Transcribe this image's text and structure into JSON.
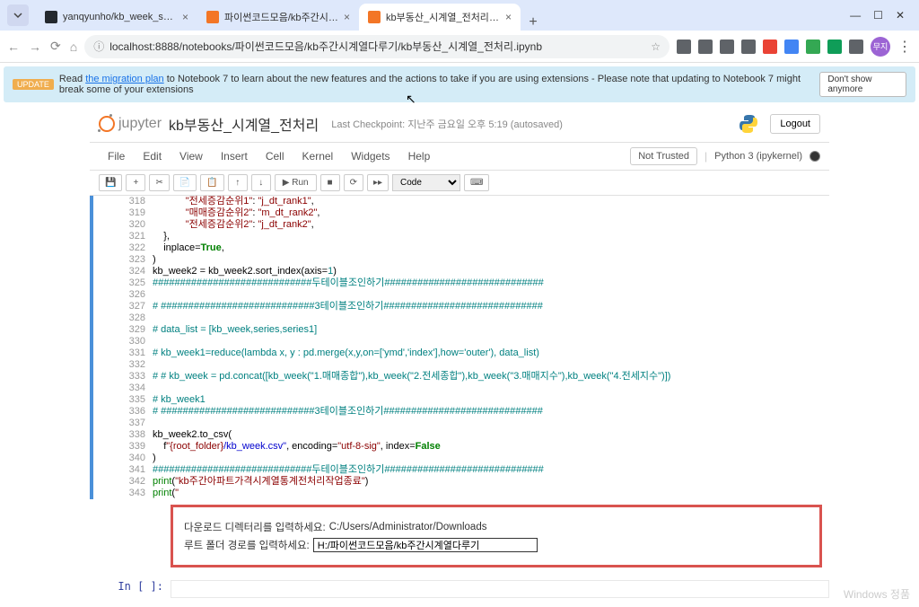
{
  "browser": {
    "tabs": [
      {
        "title": "yanqyunho/kb_week_series_pr...",
        "favicon_color": "#24292e"
      },
      {
        "title": "파이썬코드모음/kb주간시계열...",
        "favicon_color": "#f37626"
      },
      {
        "title": "kb부동산_시계열_전처리 - Jup...",
        "favicon_color": "#f37626"
      }
    ],
    "url": "localhost:8888/notebooks/파이썬코드모음/kb주간시계열다루기/kb부동산_시계열_전처리.ipynb",
    "ext_colors": [
      "#5f6368",
      "#5f6368",
      "#5f6368",
      "#5f6368",
      "#ea4335",
      "#34a853",
      "#4285f4",
      "#0f9d58",
      "#5f6368"
    ]
  },
  "banner": {
    "badge": "UPDATE",
    "prefix": "Read ",
    "link": "the migration plan",
    "suffix": " to Notebook 7 to learn about the new features and the actions to take if you are using extensions - Please note that updating to Notebook 7 might break some of your extensions",
    "dismiss": "Don't show anymore"
  },
  "jupyter": {
    "logo": "jupyter",
    "notebook_name": "kb부동산_시계열_전처리",
    "checkpoint": "Last Checkpoint: 지난주 금요일 오후 5:19  (autosaved)",
    "logout": "Logout",
    "menu": [
      "File",
      "Edit",
      "View",
      "Insert",
      "Cell",
      "Kernel",
      "Widgets",
      "Help"
    ],
    "trusted": "Not Trusted",
    "kernel": "Python 3 (ipykernel)",
    "cell_type": "Code",
    "run": "▶ Run"
  },
  "code_lines": [
    {
      "n": "318",
      "spans": [
        {
          "t": "            ",
          "c": ""
        },
        {
          "t": "\"전세증감순위1\"",
          "c": "c-maroon"
        },
        {
          "t": ": ",
          "c": ""
        },
        {
          "t": "\"j_dt_rank1\"",
          "c": "c-maroon"
        },
        {
          "t": ",",
          "c": ""
        }
      ]
    },
    {
      "n": "319",
      "spans": [
        {
          "t": "            ",
          "c": ""
        },
        {
          "t": "\"매매증감순위2\"",
          "c": "c-maroon"
        },
        {
          "t": ": ",
          "c": ""
        },
        {
          "t": "\"m_dt_rank2\"",
          "c": "c-maroon"
        },
        {
          "t": ",",
          "c": ""
        }
      ]
    },
    {
      "n": "320",
      "spans": [
        {
          "t": "            ",
          "c": ""
        },
        {
          "t": "\"전세증감순위2\"",
          "c": "c-maroon"
        },
        {
          "t": ": ",
          "c": ""
        },
        {
          "t": "\"j_dt_rank2\"",
          "c": "c-maroon"
        },
        {
          "t": ",",
          "c": ""
        }
      ]
    },
    {
      "n": "321",
      "spans": [
        {
          "t": "    },",
          "c": ""
        }
      ]
    },
    {
      "n": "322",
      "spans": [
        {
          "t": "    inplace=",
          "c": ""
        },
        {
          "t": "True",
          "c": "c-bold-green"
        },
        {
          "t": ",",
          "c": ""
        }
      ]
    },
    {
      "n": "323",
      "spans": [
        {
          "t": ")",
          "c": ""
        }
      ]
    },
    {
      "n": "324",
      "spans": [
        {
          "t": "kb_week2 = kb_week2.sort_index(axis=",
          "c": ""
        },
        {
          "t": "1",
          "c": "c-teal"
        },
        {
          "t": ")",
          "c": ""
        }
      ]
    },
    {
      "n": "325",
      "spans": [
        {
          "t": "#############################두테이블조인하기#############################",
          "c": "c-teal"
        }
      ]
    },
    {
      "n": "326",
      "spans": [
        {
          "t": "",
          "c": ""
        }
      ]
    },
    {
      "n": "327",
      "spans": [
        {
          "t": "# ############################3테이블조인하기#############################",
          "c": "c-teal"
        }
      ]
    },
    {
      "n": "328",
      "spans": [
        {
          "t": "",
          "c": ""
        }
      ]
    },
    {
      "n": "329",
      "spans": [
        {
          "t": "# data_list = [kb_week,series,series1]",
          "c": "c-teal"
        }
      ]
    },
    {
      "n": "330",
      "spans": [
        {
          "t": "",
          "c": ""
        }
      ]
    },
    {
      "n": "331",
      "spans": [
        {
          "t": "# kb_week1=reduce(lambda x, y : pd.merge(x,y,on=['ymd','index'],how='outer'), data_list)",
          "c": "c-teal"
        }
      ]
    },
    {
      "n": "332",
      "spans": [
        {
          "t": "",
          "c": ""
        }
      ]
    },
    {
      "n": "333",
      "spans": [
        {
          "t": "# # kb_week = pd.concat([kb_week(\"1.매매종합\"),kb_week(\"2.전세종합\"),kb_week(\"3.매매지수\"),kb_week(\"4.전세지수\")])",
          "c": "c-teal"
        }
      ]
    },
    {
      "n": "334",
      "spans": [
        {
          "t": "",
          "c": ""
        }
      ]
    },
    {
      "n": "335",
      "spans": [
        {
          "t": "# kb_week1",
          "c": "c-teal"
        }
      ]
    },
    {
      "n": "336",
      "spans": [
        {
          "t": "# ############################3테이블조인하기#############################",
          "c": "c-teal"
        }
      ]
    },
    {
      "n": "337",
      "spans": [
        {
          "t": "",
          "c": ""
        }
      ]
    },
    {
      "n": "338",
      "spans": [
        {
          "t": "kb_week2.to_csv(",
          "c": ""
        }
      ]
    },
    {
      "n": "339",
      "spans": [
        {
          "t": "    f",
          "c": ""
        },
        {
          "t": "\"{root_folder}",
          "c": "c-maroon"
        },
        {
          "t": "/kb_week.csv\"",
          "c": "c-blue"
        },
        {
          "t": ", encoding=",
          "c": ""
        },
        {
          "t": "\"utf-8-sig\"",
          "c": "c-maroon"
        },
        {
          "t": ", index=",
          "c": ""
        },
        {
          "t": "False",
          "c": "c-bold-green"
        }
      ]
    },
    {
      "n": "340",
      "spans": [
        {
          "t": ")",
          "c": ""
        }
      ]
    },
    {
      "n": "341",
      "spans": [
        {
          "t": "#############################두테이블조인하기#############################",
          "c": "c-teal"
        }
      ]
    },
    {
      "n": "342",
      "spans": [
        {
          "t": "print",
          "c": "c-green"
        },
        {
          "t": "(",
          "c": ""
        },
        {
          "t": "\"kb주간아파트가격시계열통계전처리작업종료\"",
          "c": "c-maroon"
        },
        {
          "t": ")",
          "c": ""
        }
      ]
    },
    {
      "n": "343",
      "spans": [
        {
          "t": "print",
          "c": "c-green"
        },
        {
          "t": "(",
          "c": ""
        },
        {
          "t": "\"",
          "c": "c-maroon"
        }
      ]
    }
  ],
  "output": {
    "prompt1": "다운로드 디렉터리를 입력하세요: ",
    "value1": "C:/Users/Administrator/Downloads",
    "prompt2": "루트 폴더 경로를 입력하세요: ",
    "input_value": "H:/파이썬코드모음/kb주간시계열다루기"
  },
  "empty_prompt": "In [ ]:",
  "watermark": "Windows 정품"
}
